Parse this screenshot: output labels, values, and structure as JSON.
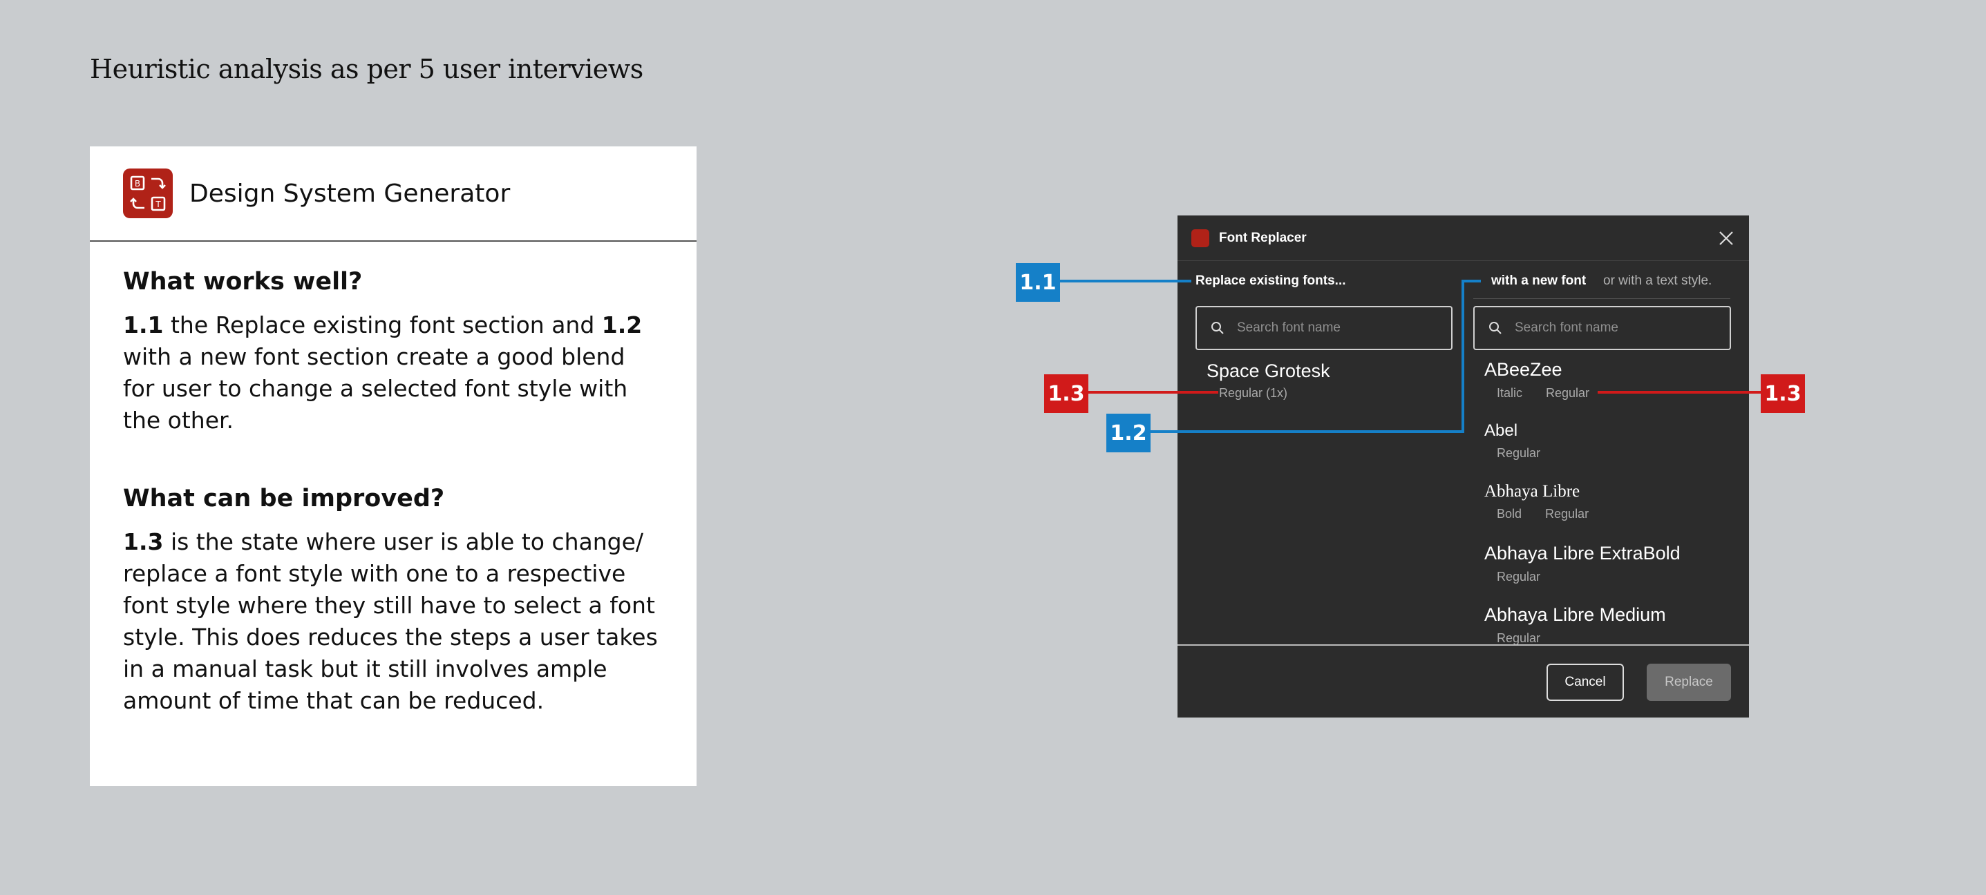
{
  "page": {
    "heading": "Heuristic analysis as per 5 user interviews"
  },
  "card": {
    "app_name": "Design System Generator",
    "works_heading": "What works well?",
    "works_text": {
      "ref1": "1.1",
      "part1": " the Replace existing font section and ",
      "ref2": "1.2",
      "part2": " with a new font section create a good blend for user to change a selected font style with the other."
    },
    "improve_heading": "What can be improved?",
    "improve_text": {
      "ref": "1.3",
      "part": " is the state where user is able to change/ replace a font style with one to a respective font style where they still have to select a font style. This does reduces the steps a user takes in a manual task but it still involves ample amount of time that can be reduced."
    }
  },
  "dialog": {
    "title": "Font Replacer",
    "left_label": "Replace existing fonts...",
    "right_label": "with a new font",
    "right_sub": "or with a text style.",
    "search_placeholder": "Search font name",
    "existing_font": {
      "name": "Space Grotesk",
      "styles": "Regular (1x)"
    },
    "fonts": [
      {
        "name": "ABeeZee",
        "styles": [
          "Italic",
          "Regular"
        ]
      },
      {
        "name": "Abel",
        "styles": [
          "Regular"
        ]
      },
      {
        "name": "Abhaya Libre",
        "styles": [
          "Bold",
          "Regular"
        ]
      },
      {
        "name": "Abhaya Libre ExtraBold",
        "styles": [
          "Regular"
        ]
      },
      {
        "name": "Abhaya Libre Medium",
        "styles": [
          "Regular"
        ]
      }
    ],
    "cancel_label": "Cancel",
    "replace_label": "Replace"
  },
  "annotations": {
    "a1": "1.1",
    "a2": "1.2",
    "a3_left": "1.3",
    "a3_right": "1.3",
    "blue_color": "#1580c8",
    "red_color": "#d11a1a"
  }
}
